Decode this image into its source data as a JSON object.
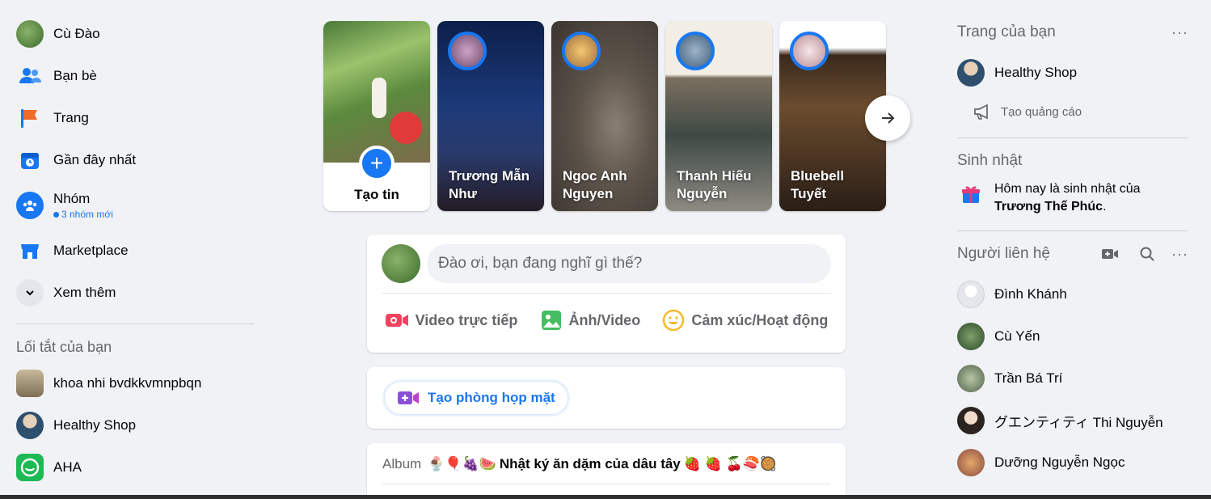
{
  "left_nav": {
    "profile": "Cù Đào",
    "friends": "Bạn bè",
    "pages": "Trang",
    "recent": "Gần đây nhất",
    "groups": "Nhóm",
    "groups_sub": "3 nhóm mới",
    "marketplace": "Marketplace",
    "see_more": "Xem thêm"
  },
  "shortcuts": {
    "title": "Lối tắt của bạn",
    "items": [
      "khoa nhi bvdkkvmnpbqn",
      "Healthy Shop",
      "AHA"
    ]
  },
  "stories": {
    "create_label": "Tạo tin",
    "items": [
      {
        "name": "Trương Mẫn Như"
      },
      {
        "name": "Ngoc Anh Nguyen"
      },
      {
        "name": "Thanh Hiếu Nguyễn"
      },
      {
        "name": "Bluebell Tuyết"
      }
    ]
  },
  "composer": {
    "placeholder": "Đào ơi, bạn đang nghĩ gì thế?",
    "live": "Video trực tiếp",
    "photo": "Ảnh/Video",
    "feeling": "Cảm xúc/Hoạt động"
  },
  "room": {
    "label": "Tạo phòng họp mặt"
  },
  "album": {
    "prefix": "Album",
    "title": "Nhật ký ăn dặm của dâu tây",
    "emoji_before": "🍨🎈🍇🍉",
    "emoji_after": "🍓 🍓 🍒🍣🥘"
  },
  "right": {
    "your_pages_title": "Trang của bạn",
    "page_name": "Healthy Shop",
    "create_ad": "Tạo quảng cáo",
    "birthday_title": "Sinh nhật",
    "birthday_text": "Hôm nay là sinh nhật của",
    "birthday_name": "Trương Thế Phúc",
    "contacts_title": "Người liên hệ",
    "contacts": [
      "Đình Khánh",
      "Cù Yến",
      "Trần Bá Trí",
      "グエンティティ Thi Nguyễn",
      "Dưỡng Nguyễn Ngọc"
    ]
  },
  "colors": {
    "primary": "#1877f2",
    "background": "#f0f2f5",
    "live_red": "#f3425f",
    "photo_green": "#45bd62",
    "feeling_yellow": "#f7b928"
  }
}
